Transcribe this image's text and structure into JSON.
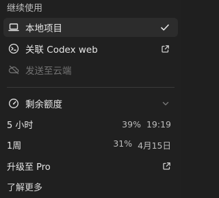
{
  "menu": {
    "section_title": "继续使用",
    "items": [
      {
        "label": "本地项目",
        "icon": "laptop-icon",
        "selected": true,
        "trailing_icon": "check-icon"
      },
      {
        "label": "关联 Codex web",
        "icon": "terminal-circle-icon",
        "selected": false,
        "trailing_icon": "external-link-icon"
      },
      {
        "label": "发送至云端",
        "icon": "cloud-off-icon",
        "selected": false,
        "disabled": true
      }
    ]
  },
  "usage": {
    "title": "剩余额度",
    "icon": "gauge-icon",
    "expand_icon": "chevron-down-icon",
    "rows": [
      {
        "label": "5 小时",
        "percent": "39%",
        "reset": "19:19"
      },
      {
        "label": "1周",
        "percent": "31%",
        "reset": "4月15日"
      }
    ]
  },
  "actions": {
    "upgrade_label": "升级至 Pro",
    "upgrade_icon": "external-link-icon",
    "learn_more_label": "了解更多"
  },
  "colors": {
    "background": "#202020",
    "selected_row": "#2c2c2c",
    "text": "#e6e6e6",
    "muted_text": "#bdbdbd",
    "disabled_text": "#727272"
  }
}
